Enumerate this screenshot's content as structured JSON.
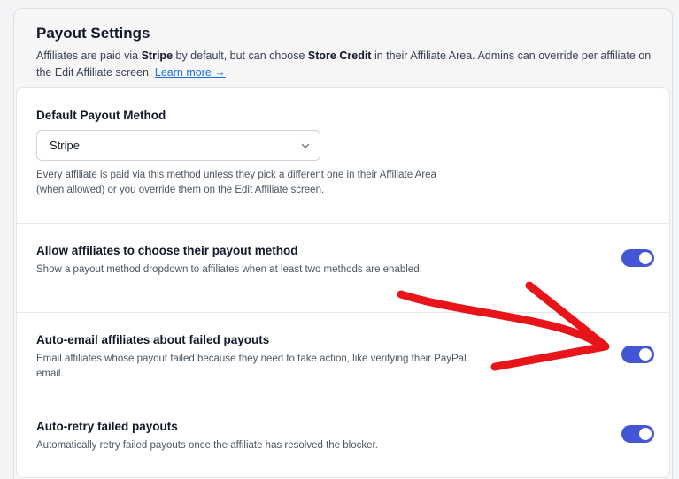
{
  "header": {
    "title": "Payout Settings",
    "desc_prefix": "Affiliates are paid via ",
    "desc_default_method": "Stripe",
    "desc_middle": " by default, but can choose ",
    "desc_alt_method": "Store Credit",
    "desc_suffix": " in their Affiliate Area. Admins can override per affiliate on the Edit Affiliate screen. ",
    "learn_more": "Learn more →"
  },
  "default_method": {
    "title": "Default Payout Method",
    "selected": "Stripe",
    "description": "Every affiliate is paid via this method unless they pick a different one in their Affiliate Area (when allowed) or you override them on the Edit Affiliate screen."
  },
  "settings": [
    {
      "title": "Allow affiliates to choose their payout method",
      "description": "Show a payout method dropdown to affiliates when at least two methods are enabled.",
      "enabled": true
    },
    {
      "title": "Auto-email affiliates about failed payouts",
      "description": "Email affiliates whose payout failed because they need to take action, like verifying their PayPal email.",
      "enabled": true
    },
    {
      "title": "Auto-retry failed payouts",
      "description": "Automatically retry failed payouts once the affiliate has resolved the blocker.",
      "enabled": true
    }
  ],
  "icons": {
    "select_chevron": "chevron-down-icon",
    "annotation": "red-arrow-annotation"
  },
  "colors": {
    "toggle_on": "#4256d6",
    "link": "#1d6fd1",
    "annotation": "#e8141a"
  }
}
